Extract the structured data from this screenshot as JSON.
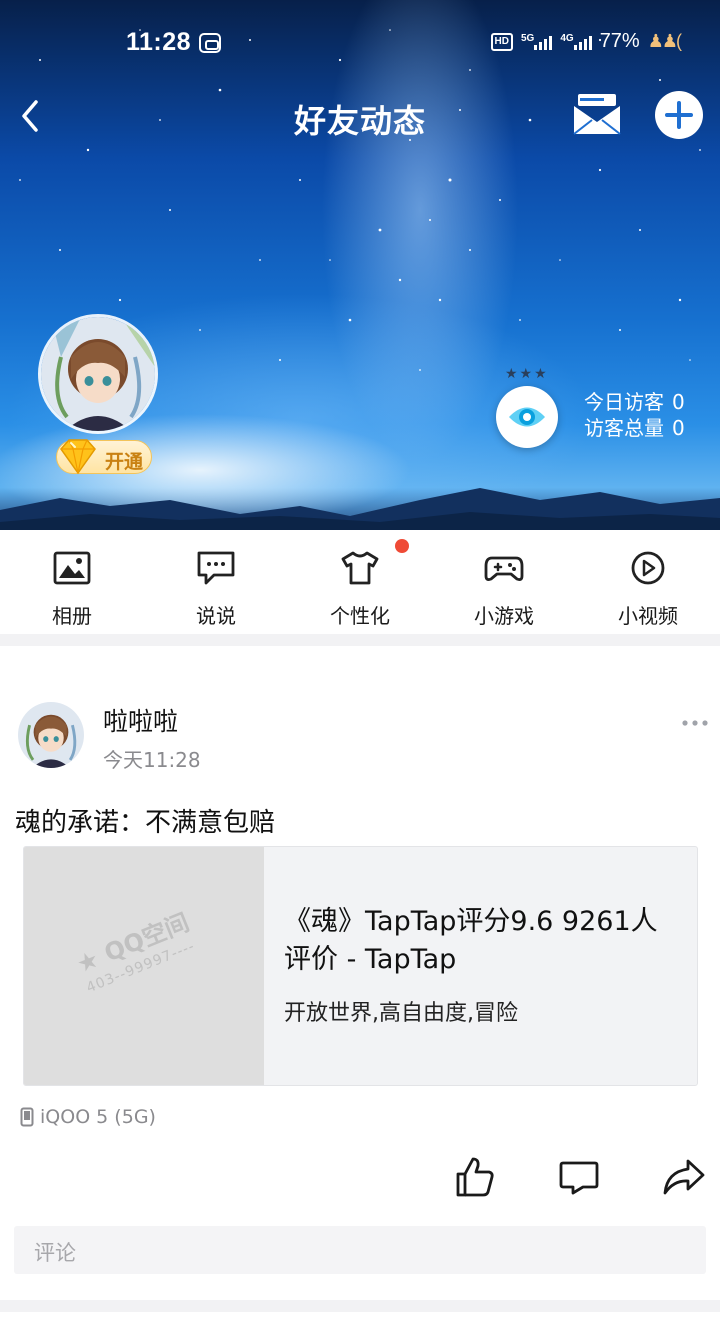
{
  "status_bar": {
    "time": "11:28",
    "hd_label": "HD",
    "net1_label": "5G",
    "net2_label": "4G",
    "battery": "77%"
  },
  "nav": {
    "title": "好友动态"
  },
  "profile": {
    "vip_label": "开通",
    "visitors_today_label": "今日访客",
    "visitors_today_value": "0",
    "visitors_total_label": "访客总量",
    "visitors_total_value": "0"
  },
  "quick_menu": [
    {
      "label": "相册",
      "icon": "album-icon"
    },
    {
      "label": "说说",
      "icon": "shuoshuo-icon"
    },
    {
      "label": "个性化",
      "icon": "tshirt-icon",
      "badge": true
    },
    {
      "label": "小游戏",
      "icon": "gamepad-icon"
    },
    {
      "label": "小视频",
      "icon": "play-icon"
    }
  ],
  "post": {
    "author": "啦啦啦",
    "time": "今天11:28",
    "text": "魂的承诺：不满意包赔",
    "card": {
      "watermark_title": "QQ空间",
      "watermark_id": "403--99997----",
      "title": "《魂》TapTap评分9.6 9261人评价 - TapTap",
      "desc": "开放世界,高自由度,冒险"
    },
    "device": "iQOO 5 (5G)",
    "comment_placeholder": "评论"
  },
  "colors": {
    "badge_red": "#ef4a36",
    "vip_gold": "#c98112",
    "meta_gray": "#8a8a8e"
  }
}
